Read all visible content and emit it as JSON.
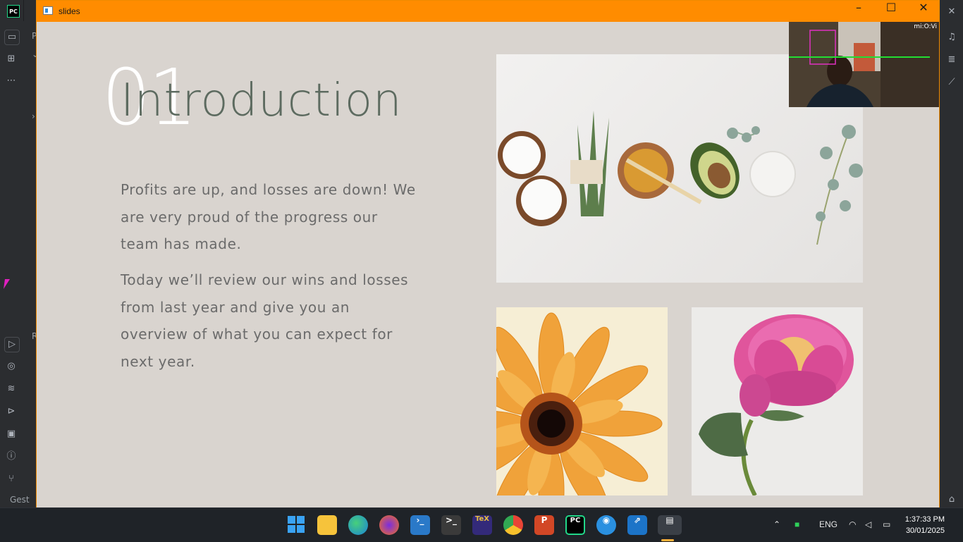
{
  "window": {
    "title": "slides"
  },
  "slide": {
    "number": "01",
    "heading": "Introduction",
    "paragraph1": "Profits are up, and losses are down! We are very proud of the progress our team has made.",
    "paragraph2": "Today we’ll review our wins and losses from last year and give you an overview of what you can expect for next year."
  },
  "webcam": {
    "overlay_text": "mi:O:Vi"
  },
  "ide": {
    "left_icons": [
      "folder-icon",
      "structure-icon",
      "more-icon",
      "run-icon",
      "python-icon",
      "layers-icon",
      "services-icon",
      "terminal-icon",
      "problems-icon",
      "git-icon"
    ],
    "bottom_status": "Gest"
  },
  "taskbar": {
    "language": "ENG",
    "time": "1:37:33 PM",
    "date": "30/01/2025",
    "apps": [
      "windows-start",
      "file-explorer",
      "edge",
      "firefox",
      "powershell",
      "terminal",
      "texworks",
      "chrome",
      "powerpoint",
      "pycharm",
      "webcam",
      "vscode-remote",
      "slides"
    ]
  }
}
